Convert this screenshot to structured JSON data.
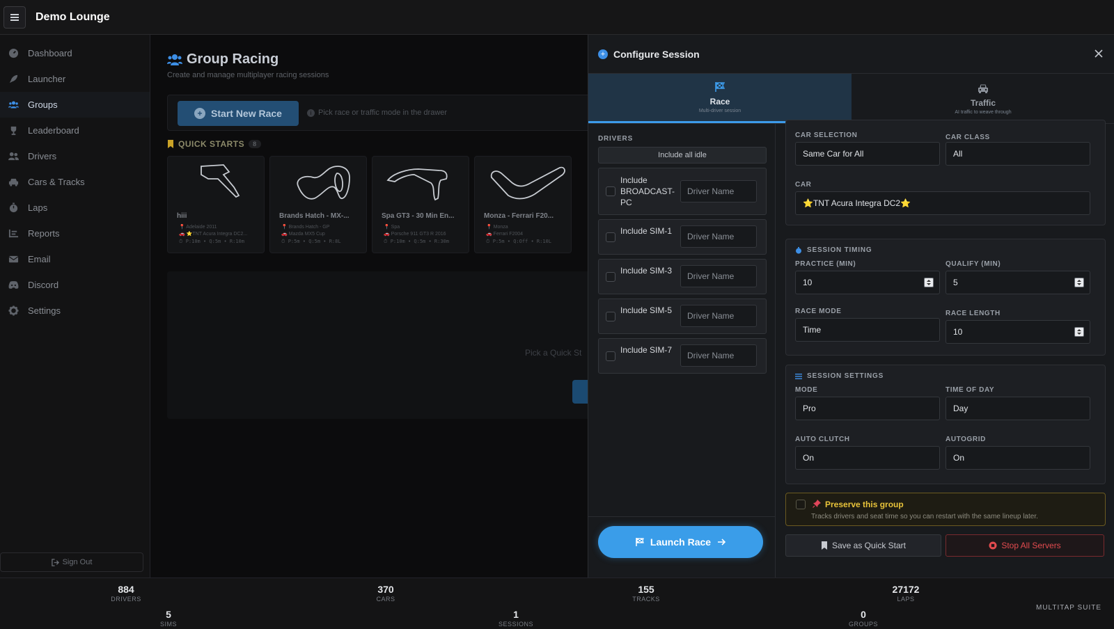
{
  "app": {
    "title": "Demo Lounge"
  },
  "sidebar": {
    "items": [
      {
        "label": "Dashboard",
        "icon": "gauge-icon"
      },
      {
        "label": "Launcher",
        "icon": "rocket-icon"
      },
      {
        "label": "Groups",
        "icon": "users-icon",
        "active": true
      },
      {
        "label": "Leaderboard",
        "icon": "trophy-icon"
      },
      {
        "label": "Drivers",
        "icon": "user-group-icon"
      },
      {
        "label": "Cars & Tracks",
        "icon": "car-icon"
      },
      {
        "label": "Laps",
        "icon": "stopwatch-icon"
      },
      {
        "label": "Reports",
        "icon": "list-icon"
      },
      {
        "label": "Email",
        "icon": "envelope-icon"
      },
      {
        "label": "Discord",
        "icon": "discord-icon"
      },
      {
        "label": "Settings",
        "icon": "gear-icon"
      }
    ],
    "sign_out": "Sign Out"
  },
  "main": {
    "title": "Group Racing",
    "subtitle": "Create and manage multiplayer racing sessions",
    "start_button": "Start New Race",
    "start_hint": "Pick race or traffic mode in the drawer",
    "quick_starts_label": "QUICK STARTS",
    "quick_starts_count": "8",
    "cards": [
      {
        "name": "hiii",
        "track": "Adelaide 2011",
        "car": "⭐TNT Acura Integra DC2...",
        "meta": "P:10m • Q:5m • R:10m"
      },
      {
        "name": "Brands Hatch - MX-...",
        "track": "Brands Hatch - GP",
        "car": "Mazda MX5 Cup",
        "meta": "P:5m • Q:5m • R:8L"
      },
      {
        "name": "Spa GT3 - 30 Min En...",
        "track": "Spa",
        "car": "Porsche 911 GT3 R 2016",
        "meta": "P:10m • Q:5m • R:30m"
      },
      {
        "name": "Monza - Ferrari F20...",
        "track": "Monza",
        "car": "Ferrari F2004",
        "meta": "P:5m • Q:Off • R:10L"
      }
    ],
    "empty_text": "Pick a Quick St"
  },
  "drawer": {
    "title": "Configure Session",
    "tabs": [
      {
        "label": "Race",
        "sub": "Multi-driver session",
        "active": true
      },
      {
        "label": "Traffic",
        "sub": "AI traffic to weave through",
        "active": false
      }
    ],
    "drivers_label": "DRIVERS",
    "include_all": "Include all idle",
    "driver_placeholder": "Driver Name",
    "drivers": [
      {
        "label": "Include BROADCAST-PC"
      },
      {
        "label": "Include SIM-1"
      },
      {
        "label": "Include SIM-3"
      },
      {
        "label": "Include SIM-5"
      },
      {
        "label": "Include SIM-7"
      }
    ],
    "launch": "Launch Race",
    "car": {
      "selection_label": "CAR SELECTION",
      "selection_value": "Same Car for All",
      "class_label": "CAR CLASS",
      "class_value": "All",
      "car_label": "CAR",
      "car_value": "⭐TNT Acura Integra DC2⭐"
    },
    "timing": {
      "title": "SESSION TIMING",
      "practice_label": "PRACTICE (MIN)",
      "practice_value": "10",
      "qualify_label": "QUALIFY (MIN)",
      "qualify_value": "5",
      "race_mode_label": "RACE MODE",
      "race_mode_value": "Time",
      "race_length_label": "RACE LENGTH",
      "race_length_value": "10"
    },
    "settings": {
      "title": "SESSION SETTINGS",
      "mode_label": "MODE",
      "mode_value": "Pro",
      "tod_label": "TIME OF DAY",
      "tod_value": "Day",
      "clutch_label": "AUTO CLUTCH",
      "clutch_value": "On",
      "grid_label": "AUTOGRID",
      "grid_value": "On"
    },
    "preserve": {
      "title": "Preserve this group",
      "sub": "Tracks drivers and seat time so you can restart with the same lineup later."
    },
    "save_quick": "Save as Quick Start",
    "stop_all": "Stop All Servers"
  },
  "footer": {
    "stats": [
      {
        "value": "884",
        "label": "DRIVERS"
      },
      {
        "value": "370",
        "label": "CARS"
      },
      {
        "value": "155",
        "label": "TRACKS"
      },
      {
        "value": "27172",
        "label": "LAPS"
      },
      {
        "value": "5",
        "label": "SIMS"
      },
      {
        "value": "1",
        "label": "SESSIONS"
      },
      {
        "value": "0",
        "label": "GROUPS"
      }
    ],
    "brand": "MULTITAP SUITE"
  },
  "colors": {
    "accent": "#3a9de9",
    "danger": "#e34b4f",
    "warning": "#e8c33a"
  }
}
